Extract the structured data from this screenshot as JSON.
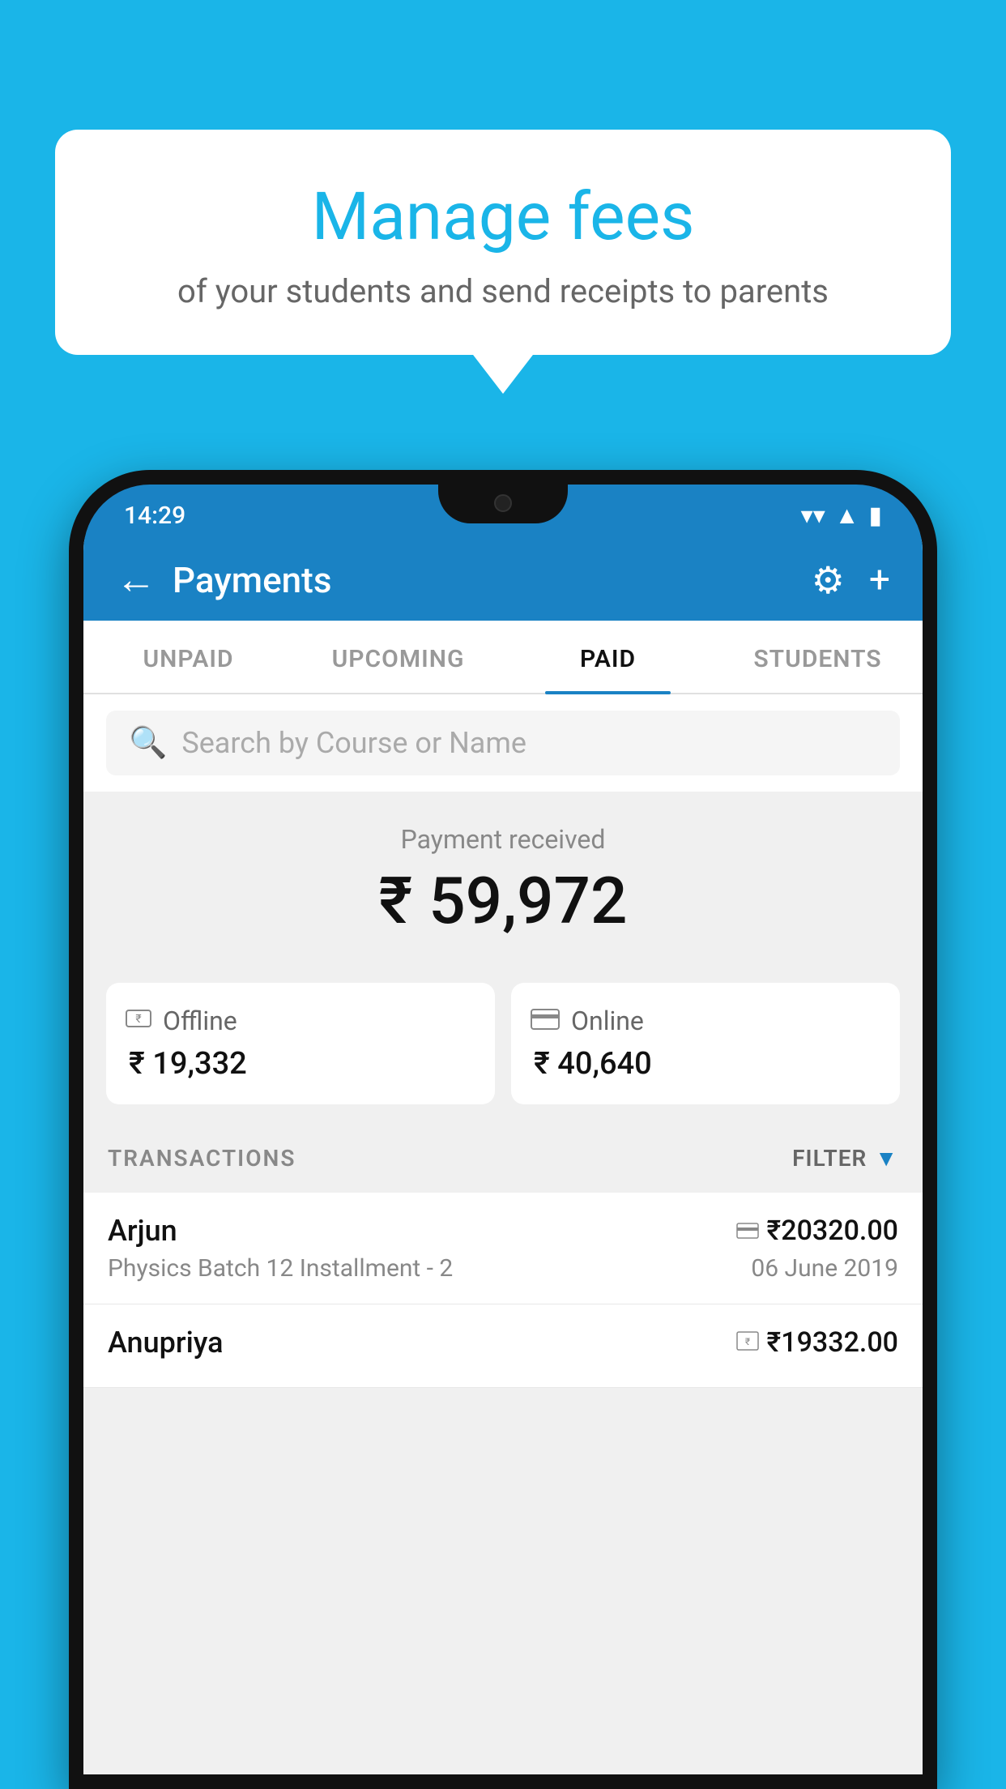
{
  "background_color": "#1ab5e8",
  "speech_bubble": {
    "title": "Manage fees",
    "subtitle": "of your students and send receipts to parents"
  },
  "status_bar": {
    "time": "14:29"
  },
  "header": {
    "title": "Payments",
    "back_label": "←",
    "gear_label": "⚙",
    "plus_label": "+"
  },
  "tabs": [
    {
      "id": "unpaid",
      "label": "UNPAID",
      "active": false
    },
    {
      "id": "upcoming",
      "label": "UPCOMING",
      "active": false
    },
    {
      "id": "paid",
      "label": "PAID",
      "active": true
    },
    {
      "id": "students",
      "label": "STUDENTS",
      "active": false
    }
  ],
  "search": {
    "placeholder": "Search by Course or Name"
  },
  "payment_received": {
    "label": "Payment received",
    "amount": "₹ 59,972"
  },
  "payment_cards": [
    {
      "id": "offline",
      "icon": "₹",
      "label": "Offline",
      "amount": "₹ 19,332"
    },
    {
      "id": "online",
      "icon": "💳",
      "label": "Online",
      "amount": "₹ 40,640"
    }
  ],
  "transactions_label": "TRANSACTIONS",
  "filter_label": "FILTER",
  "transactions": [
    {
      "name": "Arjun",
      "course": "Physics Batch 12 Installment - 2",
      "amount": "₹20320.00",
      "date": "06 June 2019",
      "type": "online"
    },
    {
      "name": "Anupriya",
      "course": "",
      "amount": "₹19332.00",
      "date": "",
      "type": "offline"
    }
  ]
}
